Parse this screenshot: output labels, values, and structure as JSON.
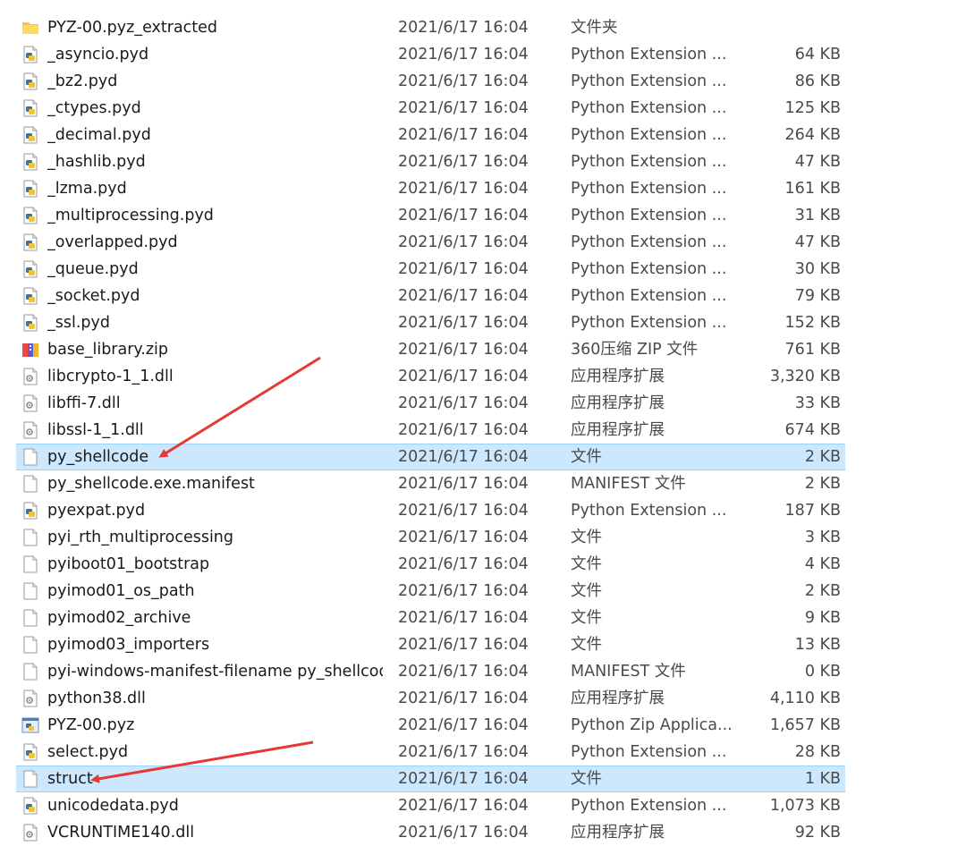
{
  "colors": {
    "selection_bg": "#cce8ff",
    "selection_border": "#99d1ff",
    "annotation_arrow": "#e53935"
  },
  "files": [
    {
      "name": "PYZ-00.pyz_extracted",
      "date": "2021/6/17 16:04",
      "type": "文件夹",
      "size": "",
      "icon": "folder-icon",
      "selected": false
    },
    {
      "name": "_asyncio.pyd",
      "date": "2021/6/17 16:04",
      "type": "Python Extension ...",
      "size": "64 KB",
      "icon": "python-file-icon",
      "selected": false
    },
    {
      "name": "_bz2.pyd",
      "date": "2021/6/17 16:04",
      "type": "Python Extension ...",
      "size": "86 KB",
      "icon": "python-file-icon",
      "selected": false
    },
    {
      "name": "_ctypes.pyd",
      "date": "2021/6/17 16:04",
      "type": "Python Extension ...",
      "size": "125 KB",
      "icon": "python-file-icon",
      "selected": false
    },
    {
      "name": "_decimal.pyd",
      "date": "2021/6/17 16:04",
      "type": "Python Extension ...",
      "size": "264 KB",
      "icon": "python-file-icon",
      "selected": false
    },
    {
      "name": "_hashlib.pyd",
      "date": "2021/6/17 16:04",
      "type": "Python Extension ...",
      "size": "47 KB",
      "icon": "python-file-icon",
      "selected": false
    },
    {
      "name": "_lzma.pyd",
      "date": "2021/6/17 16:04",
      "type": "Python Extension ...",
      "size": "161 KB",
      "icon": "python-file-icon",
      "selected": false
    },
    {
      "name": "_multiprocessing.pyd",
      "date": "2021/6/17 16:04",
      "type": "Python Extension ...",
      "size": "31 KB",
      "icon": "python-file-icon",
      "selected": false
    },
    {
      "name": "_overlapped.pyd",
      "date": "2021/6/17 16:04",
      "type": "Python Extension ...",
      "size": "47 KB",
      "icon": "python-file-icon",
      "selected": false
    },
    {
      "name": "_queue.pyd",
      "date": "2021/6/17 16:04",
      "type": "Python Extension ...",
      "size": "30 KB",
      "icon": "python-file-icon",
      "selected": false
    },
    {
      "name": "_socket.pyd",
      "date": "2021/6/17 16:04",
      "type": "Python Extension ...",
      "size": "79 KB",
      "icon": "python-file-icon",
      "selected": false
    },
    {
      "name": "_ssl.pyd",
      "date": "2021/6/17 16:04",
      "type": "Python Extension ...",
      "size": "152 KB",
      "icon": "python-file-icon",
      "selected": false
    },
    {
      "name": "base_library.zip",
      "date": "2021/6/17 16:04",
      "type": "360压缩 ZIP 文件",
      "size": "761 KB",
      "icon": "zip-archive-icon",
      "selected": false
    },
    {
      "name": "libcrypto-1_1.dll",
      "date": "2021/6/17 16:04",
      "type": "应用程序扩展",
      "size": "3,320 KB",
      "icon": "dll-file-icon",
      "selected": false
    },
    {
      "name": "libffi-7.dll",
      "date": "2021/6/17 16:04",
      "type": "应用程序扩展",
      "size": "33 KB",
      "icon": "dll-file-icon",
      "selected": false
    },
    {
      "name": "libssl-1_1.dll",
      "date": "2021/6/17 16:04",
      "type": "应用程序扩展",
      "size": "674 KB",
      "icon": "dll-file-icon",
      "selected": false
    },
    {
      "name": "py_shellcode",
      "date": "2021/6/17 16:04",
      "type": "文件",
      "size": "2 KB",
      "icon": "blank-file-icon",
      "selected": true
    },
    {
      "name": "py_shellcode.exe.manifest",
      "date": "2021/6/17 16:04",
      "type": "MANIFEST 文件",
      "size": "2 KB",
      "icon": "blank-file-icon",
      "selected": false
    },
    {
      "name": "pyexpat.pyd",
      "date": "2021/6/17 16:04",
      "type": "Python Extension ...",
      "size": "187 KB",
      "icon": "python-file-icon",
      "selected": false
    },
    {
      "name": "pyi_rth_multiprocessing",
      "date": "2021/6/17 16:04",
      "type": "文件",
      "size": "3 KB",
      "icon": "blank-file-icon",
      "selected": false
    },
    {
      "name": "pyiboot01_bootstrap",
      "date": "2021/6/17 16:04",
      "type": "文件",
      "size": "4 KB",
      "icon": "blank-file-icon",
      "selected": false
    },
    {
      "name": "pyimod01_os_path",
      "date": "2021/6/17 16:04",
      "type": "文件",
      "size": "2 KB",
      "icon": "blank-file-icon",
      "selected": false
    },
    {
      "name": "pyimod02_archive",
      "date": "2021/6/17 16:04",
      "type": "文件",
      "size": "9 KB",
      "icon": "blank-file-icon",
      "selected": false
    },
    {
      "name": "pyimod03_importers",
      "date": "2021/6/17 16:04",
      "type": "文件",
      "size": "13 KB",
      "icon": "blank-file-icon",
      "selected": false
    },
    {
      "name": "pyi-windows-manifest-filename py_shellcod...",
      "date": "2021/6/17 16:04",
      "type": "MANIFEST 文件",
      "size": "0 KB",
      "icon": "blank-file-icon",
      "selected": false
    },
    {
      "name": "python38.dll",
      "date": "2021/6/17 16:04",
      "type": "应用程序扩展",
      "size": "4,110 KB",
      "icon": "dll-file-icon",
      "selected": false
    },
    {
      "name": "PYZ-00.pyz",
      "date": "2021/6/17 16:04",
      "type": "Python Zip Applica...",
      "size": "1,657 KB",
      "icon": "python-zip-icon",
      "selected": false
    },
    {
      "name": "select.pyd",
      "date": "2021/6/17 16:04",
      "type": "Python Extension ...",
      "size": "28 KB",
      "icon": "python-file-icon",
      "selected": false
    },
    {
      "name": "struct",
      "date": "2021/6/17 16:04",
      "type": "文件",
      "size": "1 KB",
      "icon": "blank-file-icon",
      "selected": true
    },
    {
      "name": "unicodedata.pyd",
      "date": "2021/6/17 16:04",
      "type": "Python Extension ...",
      "size": "1,073 KB",
      "icon": "python-file-icon",
      "selected": false
    },
    {
      "name": "VCRUNTIME140.dll",
      "date": "2021/6/17 16:04",
      "type": "应用程序扩展",
      "size": "92 KB",
      "icon": "dll-file-icon",
      "selected": false
    }
  ]
}
